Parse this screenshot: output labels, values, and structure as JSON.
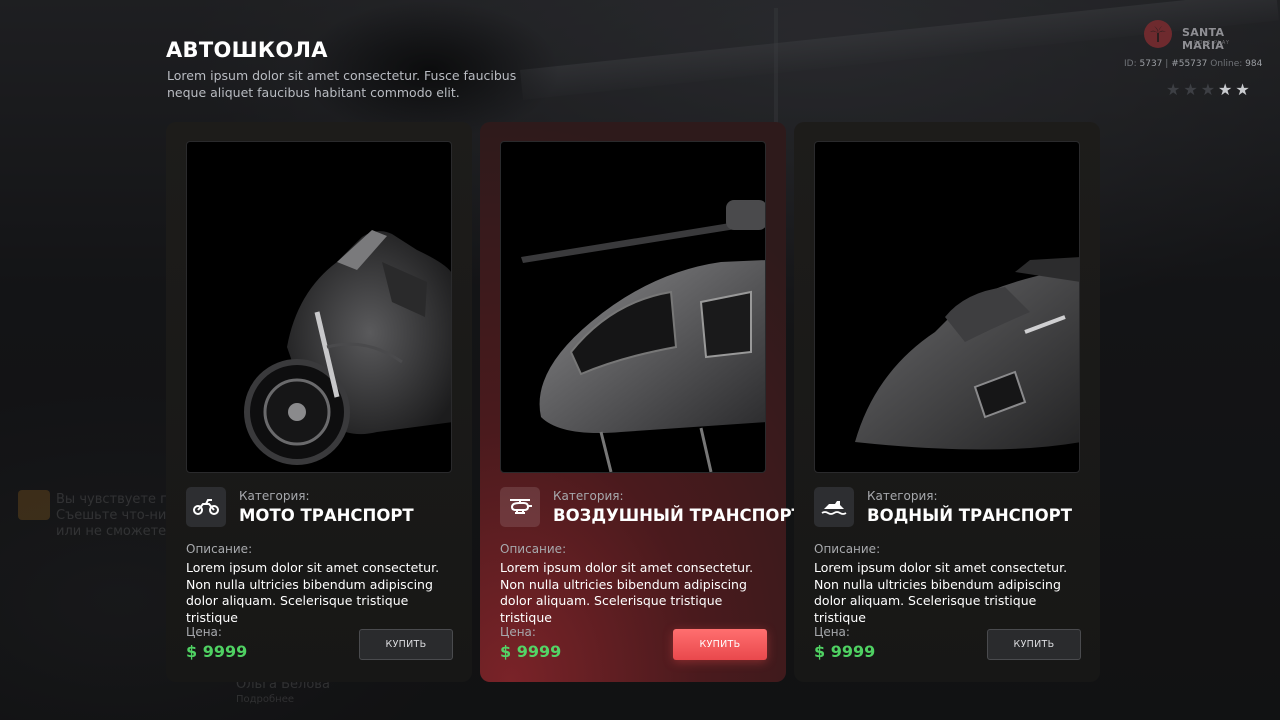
{
  "header": {
    "title": "АВТОШКОЛА",
    "subtitle": "Lorem ipsum dolor sit amet consectetur. Fusce faucibus neque aliquet faucibus habitant commodo elit."
  },
  "brand": {
    "name": "SANTA MARIA",
    "tagline": "ROLE PLAY"
  },
  "server_info": {
    "id_label": "ID:",
    "id_value": "5737",
    "hash_value": "#55737",
    "online_label": "Online:",
    "online_value": "984"
  },
  "wanted_level": {
    "total_stars": 5,
    "active_stars": 2
  },
  "background_ghost_text": {
    "line1": "Вы чувствуете голо",
    "line2": "Съешьте что-нибудь",
    "line3": "или не сможете",
    "line4": "Ольга Белова",
    "line5": "Подробнее"
  },
  "labels": {
    "category": "Категория:",
    "description": "Описание:",
    "price": "Цена:"
  },
  "cards": [
    {
      "category_value": "МОТО ТРАНСПОРТ",
      "icon": "motorcycle-icon",
      "description": "Lorem ipsum dolor sit amet consectetur. Non nulla ultricies bibendum adipiscing dolor aliquam. Scelerisque tristique tristique",
      "price": "$ 9999",
      "button_label": "КУПИТЬ",
      "image": "motorcycle",
      "highlighted": false
    },
    {
      "category_value": "ВОЗДУШНЫЙ ТРАНСПОРТ",
      "icon": "helicopter-icon",
      "description": "Lorem ipsum dolor sit amet consectetur. Non nulla ultricies bibendum adipiscing dolor aliquam. Scelerisque tristique tristique",
      "price": "$ 9999",
      "button_label": "КУПИТЬ",
      "image": "helicopter",
      "highlighted": true
    },
    {
      "category_value": "ВОДНЫЙ ТРАНСПОРТ",
      "icon": "jetski-icon",
      "description": "Lorem ipsum dolor sit amet consectetur. Non nulla ultricies bibendum adipiscing dolor aliquam. Scelerisque tristique tristique",
      "price": "$ 9999",
      "button_label": "КУПИТЬ",
      "image": "jetski",
      "highlighted": false
    }
  ],
  "colors": {
    "accent_red": "#e9484c",
    "price_green": "#4fd162",
    "card_bg": "#1b1c1e"
  }
}
